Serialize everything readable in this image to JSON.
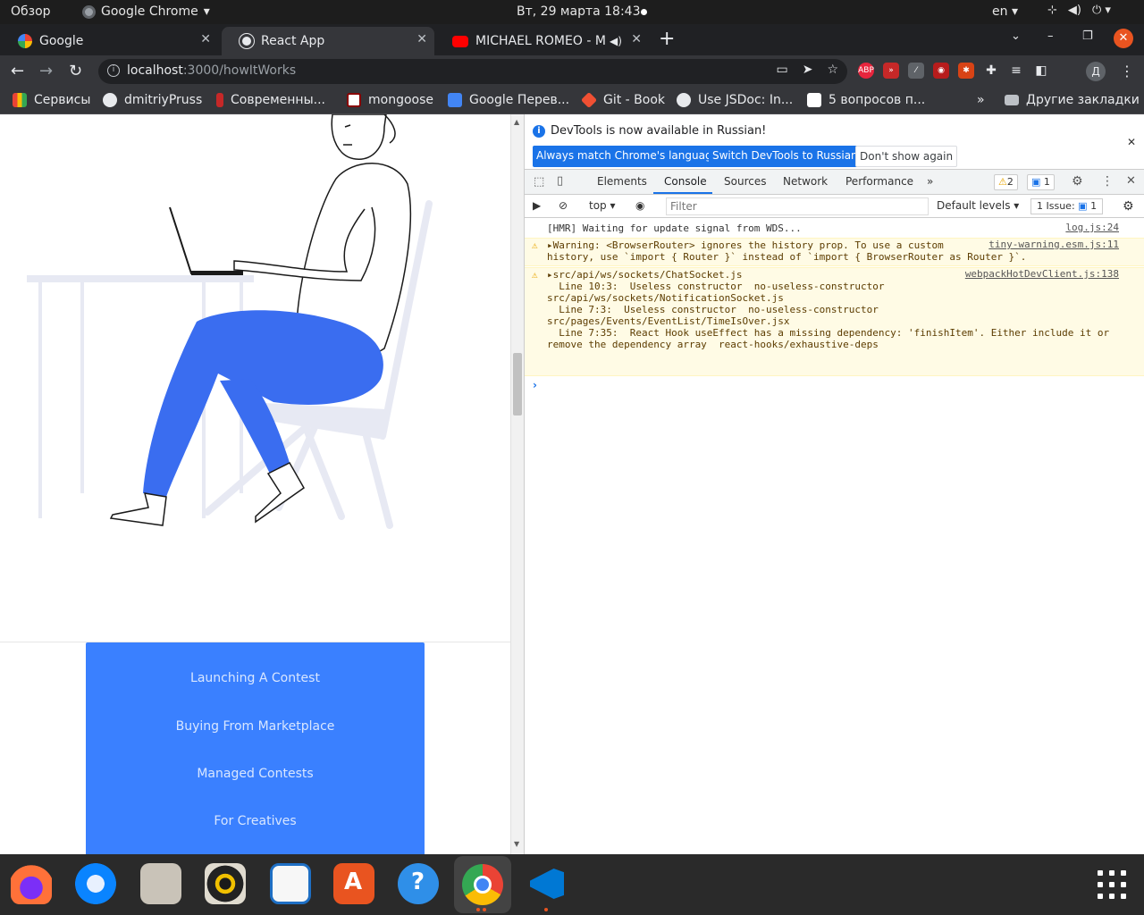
{
  "topbar": {
    "overview": "Обзор",
    "app_name": "Google Chrome",
    "clock": "Вт, 29 марта  18:43",
    "lang": "en"
  },
  "tabs": [
    {
      "title": "Google",
      "icon": "google-icon"
    },
    {
      "title": "React App",
      "icon": "globe-icon"
    },
    {
      "title": "MICHAEL ROMEO - Me",
      "icon": "youtube-icon"
    }
  ],
  "toolbar": {
    "url_host": "localhost",
    "url_path": ":3000/howItWorks",
    "profile_initial": "Д"
  },
  "bookmarks": [
    {
      "label": "Сервисы",
      "icon": "apps-grid-icon"
    },
    {
      "label": "dmitriyPruss",
      "icon": "github-icon"
    },
    {
      "label": "Современны...",
      "icon": "bookmark-icon"
    },
    {
      "label": "mongoose",
      "icon": "mongoose-icon"
    },
    {
      "label": "Google Перев...",
      "icon": "translate-icon"
    },
    {
      "label": "Git - Book",
      "icon": "git-icon"
    },
    {
      "label": "Use JSDoc: In...",
      "icon": "globe-icon"
    },
    {
      "label": "5 вопросов п...",
      "icon": "medium-icon"
    },
    {
      "label": "»",
      "icon": ""
    },
    {
      "label": "Другие закладки",
      "icon": "folder-icon"
    }
  ],
  "page": {
    "menu_items": [
      "Launching A Contest",
      "Buying From Marketplace",
      "Managed Contests",
      "For Creatives"
    ]
  },
  "devtools": {
    "info_message": "DevTools is now available in Russian!",
    "btn_match": "Always match Chrome's language",
    "btn_switch": "Switch DevTools to Russian",
    "btn_dont": "Don't show again",
    "tabs": [
      "Elements",
      "Console",
      "Sources",
      "Network",
      "Performance"
    ],
    "more_tabs": "»",
    "warn_count": "2",
    "msg_count": "1",
    "context": "top",
    "filter_placeholder": "Filter",
    "levels": "Default levels",
    "issues": "1 Issue:",
    "issues_count": "1",
    "logs": [
      {
        "type": "info",
        "lines": [
          "[HMR] Waiting for update signal from WDS..."
        ],
        "source": "log.js:24"
      },
      {
        "type": "warn",
        "lines": [
          "▸Warning: <BrowserRouter> ignores the history prop. To use a custom",
          "history, use `import { Router }` instead of `import { BrowserRouter as Router }`."
        ],
        "source": "tiny-warning.esm.js:11"
      },
      {
        "type": "warn",
        "lines": [
          "▸src/api/ws/sockets/ChatSocket.js",
          "  Line 10:3:  Useless constructor  no-useless-constructor",
          "",
          "src/api/ws/sockets/NotificationSocket.js",
          "  Line 7:3:  Useless constructor  no-useless-constructor",
          "",
          "src/pages/Events/EventList/TimeIsOver.jsx",
          "  Line 7:35:  React Hook useEffect has a missing dependency: 'finishItem'. Either include it or",
          "remove the dependency array  react-hooks/exhaustive-deps"
        ],
        "source": "webpackHotDevClient.js:138"
      }
    ],
    "prompt": "›"
  },
  "dock": [
    {
      "name": "firefox"
    },
    {
      "name": "thunderbird"
    },
    {
      "name": "files"
    },
    {
      "name": "rhythmbox"
    },
    {
      "name": "libreoffice-writer"
    },
    {
      "name": "software"
    },
    {
      "name": "help"
    },
    {
      "name": "chrome"
    },
    {
      "name": "vscode"
    }
  ]
}
